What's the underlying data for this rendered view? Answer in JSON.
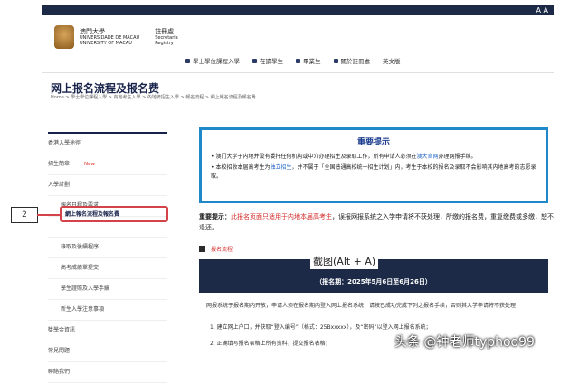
{
  "topbar": {
    "font_size_label": "A A"
  },
  "header": {
    "university_cn": "澳門大學",
    "university_pt": "UNIVERSIDADE DE MACAU",
    "university_en": "UNIVERSITY OF MACAU",
    "office_cn": "註冊處",
    "office_pt": "Secretaria",
    "office_en": "Registry"
  },
  "nav": [
    {
      "label": "學士學位課程入學",
      "icon": "graduation-icon"
    },
    {
      "label": "在讀學生",
      "icon": "student-icon"
    },
    {
      "label": "畢業生",
      "icon": "graduate-icon"
    },
    {
      "label": "關於註冊處",
      "icon": "info-icon"
    },
    {
      "label": "英文版",
      "icon": ""
    }
  ],
  "page": {
    "title": "网上报名流程及报名费",
    "breadcrumb": "Home > 學士學位課程入學 > 內地考生入學 > 內地統招生入學 > 報名流程 > 網上報名流程及報名費"
  },
  "sidebar": {
    "items": [
      {
        "label": "香港入學途徑"
      },
      {
        "label": "招生簡章",
        "badge": "New"
      },
      {
        "label": "入學計劃"
      },
      {
        "label": "報名日程及要求"
      },
      {
        "label": "網上報名流程及報名費"
      },
      {
        "label": "錄取及後續程序"
      },
      {
        "label": "高考成績單提交"
      },
      {
        "label": "學生證照及入學手續"
      },
      {
        "label": "新生入學注意事項"
      },
      {
        "label": "獎學金資訊"
      },
      {
        "label": "常見問題"
      },
      {
        "label": "聯絡我們"
      }
    ]
  },
  "annotation": {
    "number": "2"
  },
  "notice": {
    "title": "重要提示",
    "b1_a": "澳门大学于内地并没有委托任何机构或中介办理招生及录取工作，所有申请人必须在",
    "b1_link": "澳大官网",
    "b1_b": "办理网报手续。",
    "b2_a": "本校招收本届高考生为",
    "b2_u": "独立招生",
    "b2_b": "，并不属于「全国普通高校统一招生计划」内，考生于本校的报名及录取不会影响其内地高考的志愿录取。"
  },
  "reminder": {
    "label": "重要提示：",
    "red": "此报名页面只适用于内地本届高考生",
    "rest": "，误报网报系统之入学申请将不获处理，所缴的报名费，重复缴费或多缴，恕不退还。"
  },
  "process": {
    "label": "报名流程"
  },
  "capture_tooltip": "截图(Alt + A)",
  "period": "（报名期：2025年5月6日至6月26日）",
  "body_lines": {
    "l1": "网报系统于报名期内开放，申请人须在报名期内登入网上报名系统，请按已成功完成下列之报名手续，否则其入学申请将不获处理：",
    "l2": "1. 建立网上户口，并获取“登入编号”（格式：25Bxxxxx），及“密码”以登入网上报名系统；",
    "l3": "2. 正确填写报名表格上所有资料，提交报名表格；"
  },
  "watermark": "头条 @钟老师typhoo99",
  "colors": {
    "navy": "#1c2a47",
    "accent_red": "#d42a2a",
    "border_blue": "#1e88c8"
  }
}
